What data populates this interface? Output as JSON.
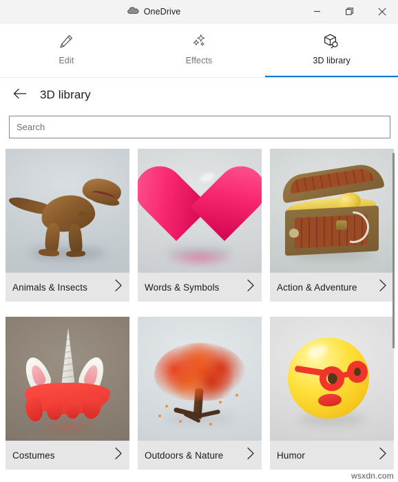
{
  "titlebar": {
    "app_title": "OneDrive",
    "app_icon": "onedrive-cloud-icon",
    "minimize_label": "Minimize",
    "restore_label": "Restore",
    "close_label": "Close"
  },
  "tabs": [
    {
      "id": "edit",
      "label": "Edit",
      "icon": "pencil-icon",
      "active": false
    },
    {
      "id": "effects",
      "label": "Effects",
      "icon": "sparkles-icon",
      "active": false
    },
    {
      "id": "3d-library",
      "label": "3D library",
      "icon": "cube-search-icon",
      "active": true
    }
  ],
  "header": {
    "back_label": "Back",
    "back_icon": "arrow-left-icon",
    "title": "3D library"
  },
  "search": {
    "placeholder": "Search",
    "value": ""
  },
  "library": {
    "cards": [
      {
        "label": "Animals & Insects",
        "thumbnail": "t-rex-dinosaur-render",
        "chevron_icon": "chevron-right-icon"
      },
      {
        "label": "Words & Symbols",
        "thumbnail": "pink-heart-render",
        "chevron_icon": "chevron-right-icon"
      },
      {
        "label": "Action & Adventure",
        "thumbnail": "treasure-chest-render",
        "chevron_icon": "chevron-right-icon"
      },
      {
        "label": "Costumes",
        "thumbnail": "unicorn-horn-headband-render",
        "chevron_icon": "chevron-right-icon"
      },
      {
        "label": "Outdoors & Nature",
        "thumbnail": "autumn-tree-render",
        "chevron_icon": "chevron-right-icon"
      },
      {
        "label": "Humor",
        "thumbnail": "emoji-with-glasses-render",
        "chevron_icon": "chevron-right-icon"
      }
    ]
  },
  "scrollbar": {
    "orientation": "vertical"
  },
  "watermark": {
    "text": "wsxdn.com"
  },
  "colors": {
    "accent": "#0078d4",
    "titlebar_bg": "#f3f3f3",
    "card_label_bg": "#e6e6e6",
    "text_primary": "#1a1a1a",
    "text_muted": "#767676"
  }
}
